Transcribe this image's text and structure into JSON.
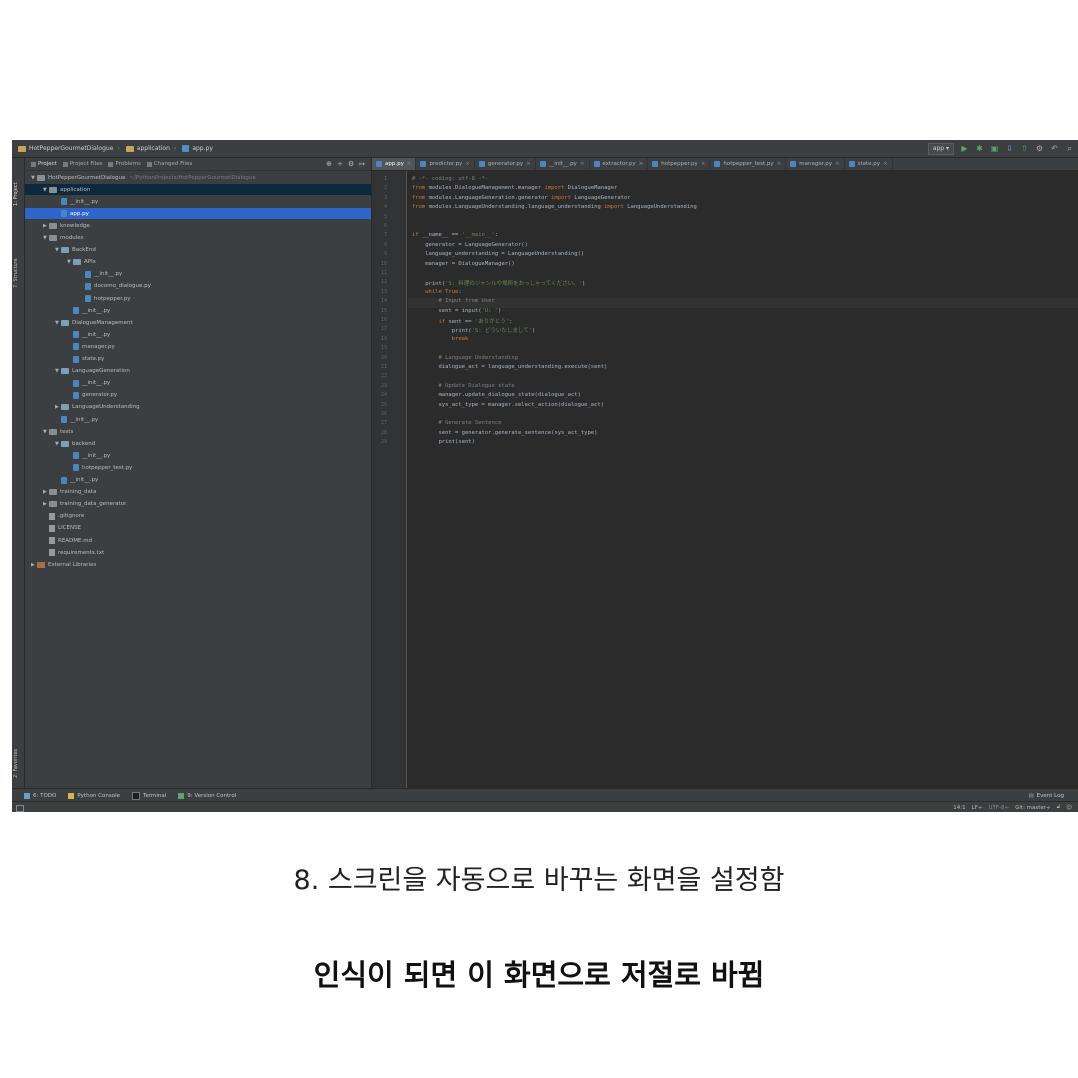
{
  "navbar": {
    "project_name": "HotPepperGourmetDialogue",
    "folder": "application",
    "file": "app.py",
    "run_config": "app"
  },
  "left_stripe": {
    "project_label": "1: Project",
    "structure_label": "7: Structure",
    "favorites_label": "2: Favorites"
  },
  "project_panel": {
    "tabs": [
      "Project",
      "Project Files",
      "Problems",
      "Changed Files"
    ],
    "root_path": "~/PythonProjects/HotPepperGourmetDialogue",
    "tree": [
      {
        "label": "HotPepperGourmetDialogue",
        "type": "folder",
        "depth": 0,
        "arrow": "▼",
        "path": "~/PythonProjects/HotPepperGourmetDialogue"
      },
      {
        "label": "application",
        "type": "folder",
        "depth": 1,
        "arrow": "▼",
        "selected": "soft"
      },
      {
        "label": "__init__.py",
        "type": "py",
        "depth": 2,
        "arrow": ""
      },
      {
        "label": "app.py",
        "type": "py",
        "depth": 2,
        "arrow": "",
        "selected": "strong"
      },
      {
        "label": "knowledge",
        "type": "folder",
        "depth": 1,
        "arrow": "▶"
      },
      {
        "label": "modules",
        "type": "folder",
        "depth": 1,
        "arrow": "▼"
      },
      {
        "label": "BackEnd",
        "type": "module",
        "depth": 2,
        "arrow": "▼"
      },
      {
        "label": "APIs",
        "type": "module",
        "depth": 3,
        "arrow": "▼"
      },
      {
        "label": "__init__.py",
        "type": "py",
        "depth": 4,
        "arrow": ""
      },
      {
        "label": "docomo_dialogue.py",
        "type": "py",
        "depth": 4,
        "arrow": ""
      },
      {
        "label": "hotpepper.py",
        "type": "py",
        "depth": 4,
        "arrow": ""
      },
      {
        "label": "__init__.py",
        "type": "py",
        "depth": 3,
        "arrow": ""
      },
      {
        "label": "DialogueManagement",
        "type": "module",
        "depth": 2,
        "arrow": "▼"
      },
      {
        "label": "__init__.py",
        "type": "py",
        "depth": 3,
        "arrow": ""
      },
      {
        "label": "manager.py",
        "type": "py",
        "depth": 3,
        "arrow": ""
      },
      {
        "label": "state.py",
        "type": "py",
        "depth": 3,
        "arrow": ""
      },
      {
        "label": "LanguageGeneration",
        "type": "module",
        "depth": 2,
        "arrow": "▼"
      },
      {
        "label": "__init__.py",
        "type": "py",
        "depth": 3,
        "arrow": ""
      },
      {
        "label": "generator.py",
        "type": "py",
        "depth": 3,
        "arrow": ""
      },
      {
        "label": "LanguageUnderstanding",
        "type": "module",
        "depth": 2,
        "arrow": "▶"
      },
      {
        "label": "__init__.py",
        "type": "py",
        "depth": 2,
        "arrow": ""
      },
      {
        "label": "tests",
        "type": "folder",
        "depth": 1,
        "arrow": "▼"
      },
      {
        "label": "backend",
        "type": "module",
        "depth": 2,
        "arrow": "▼"
      },
      {
        "label": "__init__.py",
        "type": "py",
        "depth": 3,
        "arrow": ""
      },
      {
        "label": "hotpepper_test.py",
        "type": "py",
        "depth": 3,
        "arrow": ""
      },
      {
        "label": "__init__.py",
        "type": "py",
        "depth": 2,
        "arrow": ""
      },
      {
        "label": "training_data",
        "type": "folder",
        "depth": 1,
        "arrow": "▶"
      },
      {
        "label": "training_data_generator",
        "type": "folder",
        "depth": 1,
        "arrow": "▶"
      },
      {
        "label": ".gitignore",
        "type": "txt",
        "depth": 1,
        "arrow": ""
      },
      {
        "label": "LICENSE",
        "type": "txt",
        "depth": 1,
        "arrow": ""
      },
      {
        "label": "README.md",
        "type": "txt",
        "depth": 1,
        "arrow": ""
      },
      {
        "label": "requirements.txt",
        "type": "txt",
        "depth": 1,
        "arrow": ""
      },
      {
        "label": "External Libraries",
        "type": "lib",
        "depth": 0,
        "arrow": "▶"
      }
    ]
  },
  "editor": {
    "tabs": [
      {
        "label": "app.py",
        "active": true
      },
      {
        "label": "predictor.py",
        "active": false
      },
      {
        "label": "generator.py",
        "active": false
      },
      {
        "label": "__init__.py",
        "active": false
      },
      {
        "label": "extractor.py",
        "active": false
      },
      {
        "label": "hotpepper.py",
        "active": false
      },
      {
        "label": "hotpepper_test.py",
        "active": false
      },
      {
        "label": "manager.py",
        "active": false
      },
      {
        "label": "state.py",
        "active": false
      }
    ],
    "caret_line": 14,
    "code": [
      [
        {
          "t": "# -*- coding: utf-8 -*-",
          "c": "#808080"
        }
      ],
      [
        {
          "t": "from ",
          "c": "#cc7832"
        },
        {
          "t": "modules.DialogueManagement.manager ",
          "c": "#a9b7c6"
        },
        {
          "t": "import ",
          "c": "#cc7832"
        },
        {
          "t": "DialogueManager",
          "c": "#a9b7c6"
        }
      ],
      [
        {
          "t": "from ",
          "c": "#cc7832"
        },
        {
          "t": "modules.LanguageGeneration.generator ",
          "c": "#a9b7c6"
        },
        {
          "t": "import ",
          "c": "#cc7832"
        },
        {
          "t": "LanguageGenerator",
          "c": "#a9b7c6"
        }
      ],
      [
        {
          "t": "from ",
          "c": "#cc7832"
        },
        {
          "t": "modules.LanguageUnderstanding.language_understanding ",
          "c": "#a9b7c6"
        },
        {
          "t": "import ",
          "c": "#cc7832"
        },
        {
          "t": "LanguageUnderstanding",
          "c": "#a9b7c6"
        }
      ],
      [],
      [],
      [
        {
          "t": "if ",
          "c": "#cc7832"
        },
        {
          "t": "__name__ == ",
          "c": "#a9b7c6"
        },
        {
          "t": "'__main__'",
          "c": "#6a8759"
        },
        {
          "t": ":",
          "c": "#a9b7c6"
        }
      ],
      [
        {
          "t": "    generator = LanguageGenerator()",
          "c": "#a9b7c6"
        }
      ],
      [
        {
          "t": "    language_understanding = LanguageUnderstanding()",
          "c": "#a9b7c6"
        }
      ],
      [
        {
          "t": "    manager = DialogueManager()",
          "c": "#a9b7c6"
        }
      ],
      [],
      [
        {
          "t": "    print",
          "c": "#a9b7c6"
        },
        {
          "t": "(",
          "c": "#a9b7c6"
        },
        {
          "t": "'S: 料理のジャンルや場所をおっしゃってください。'",
          "c": "#6a8759"
        },
        {
          "t": ")",
          "c": "#a9b7c6"
        }
      ],
      [
        {
          "t": "    while ",
          "c": "#cc7832"
        },
        {
          "t": "True",
          "c": "#cc7832"
        },
        {
          "t": ":",
          "c": "#a9b7c6"
        }
      ],
      [
        {
          "t": "        # Input from User",
          "c": "#808080"
        }
      ],
      [
        {
          "t": "        sent = input(",
          "c": "#a9b7c6"
        },
        {
          "t": "'U: '",
          "c": "#6a8759"
        },
        {
          "t": ")",
          "c": "#a9b7c6"
        }
      ],
      [
        {
          "t": "        if ",
          "c": "#cc7832"
        },
        {
          "t": "sent == ",
          "c": "#a9b7c6"
        },
        {
          "t": "'ありがとう'",
          "c": "#6a8759"
        },
        {
          "t": ":",
          "c": "#a9b7c6"
        }
      ],
      [
        {
          "t": "            print(",
          "c": "#a9b7c6"
        },
        {
          "t": "'S: どういたしまして'",
          "c": "#6a8759"
        },
        {
          "t": ")",
          "c": "#a9b7c6"
        }
      ],
      [
        {
          "t": "            break",
          "c": "#cc7832"
        }
      ],
      [],
      [
        {
          "t": "        # Language Understanding",
          "c": "#808080"
        }
      ],
      [
        {
          "t": "        dialogue_act = language_understanding.execute(sent)",
          "c": "#a9b7c6"
        }
      ],
      [],
      [
        {
          "t": "        # Update Dialogue state",
          "c": "#808080"
        }
      ],
      [
        {
          "t": "        manager.update_dialogue_state(dialogue_act)",
          "c": "#a9b7c6"
        }
      ],
      [
        {
          "t": "        sys_act_type = manager.select_action(dialogue_act)",
          "c": "#a9b7c6"
        }
      ],
      [],
      [
        {
          "t": "        # Generate Sentence",
          "c": "#808080"
        }
      ],
      [
        {
          "t": "        sent = generator.generate_sentence(sys_act_type)",
          "c": "#a9b7c6"
        }
      ],
      [
        {
          "t": "        print(sent)",
          "c": "#a9b7c6"
        }
      ]
    ]
  },
  "bottom_tools": {
    "todo": "6: TODO",
    "python_console": "Python Console",
    "terminal": "Terminal",
    "vcs": "9: Version Control",
    "event_log": "Event Log"
  },
  "status": {
    "position": "14:1",
    "line_sep": "LF÷",
    "encoding": "UTF-8÷",
    "git": "Git: master÷"
  },
  "captions": {
    "line1": "8. 스크린을 자동으로 바꾸는 화면을 설정함",
    "line2": "인식이 되면 이 화면으로 저절로 바뀜"
  }
}
